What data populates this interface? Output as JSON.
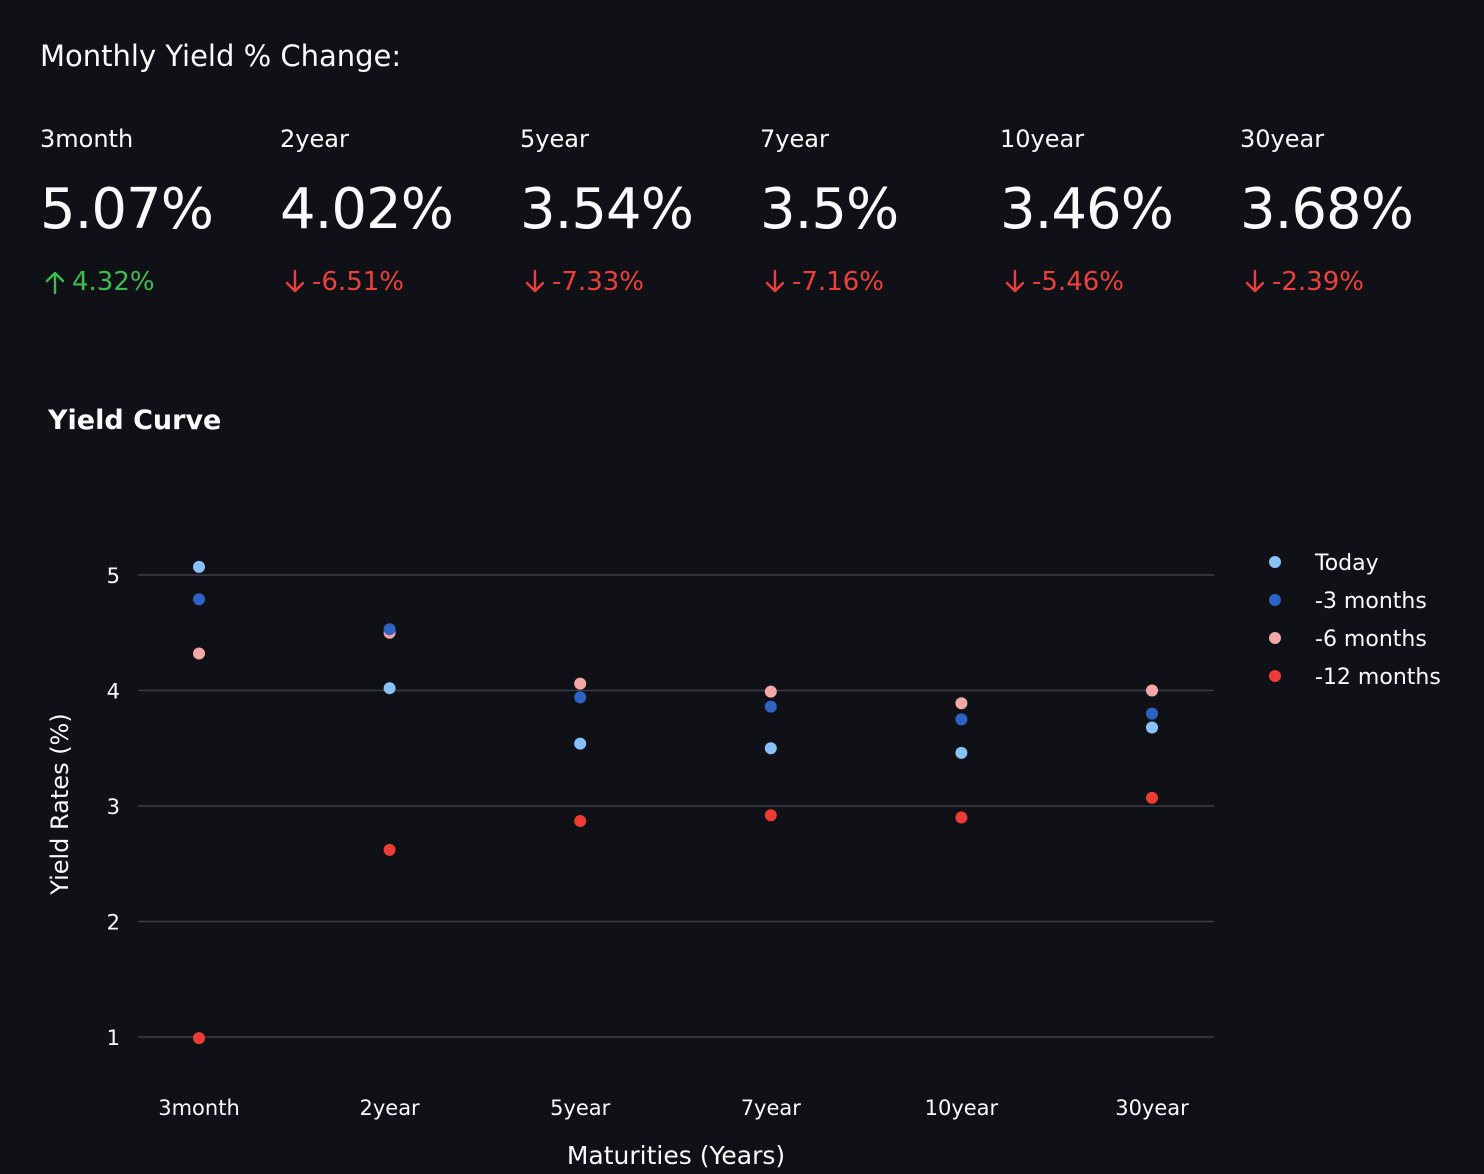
{
  "header": {
    "title": "Monthly Yield % Change:"
  },
  "metrics": [
    {
      "label": "3month",
      "value": "5.07%",
      "delta": "4.32%",
      "direction": "up"
    },
    {
      "label": "2year",
      "value": "4.02%",
      "delta": "-6.51%",
      "direction": "down"
    },
    {
      "label": "5year",
      "value": "3.54%",
      "delta": "-7.33%",
      "direction": "down"
    },
    {
      "label": "7year",
      "value": "3.5%",
      "delta": "-7.16%",
      "direction": "down"
    },
    {
      "label": "10year",
      "value": "3.46%",
      "delta": "-5.46%",
      "direction": "down"
    },
    {
      "label": "30year",
      "value": "3.68%",
      "delta": "-2.39%",
      "direction": "down"
    }
  ],
  "colors": {
    "background": "#0f1116",
    "text": "#fafafa",
    "positive": "#3dbd4f",
    "negative": "#ef3f3a",
    "grid": "#3b3d45"
  },
  "icons": {
    "up": "arrow-up-icon",
    "down": "arrow-down-icon"
  },
  "chart_data": {
    "type": "scatter",
    "title": "Yield Curve",
    "xlabel": "Maturities (Years)",
    "ylabel": "Yield Rates (%)",
    "categories": [
      "3month",
      "2year",
      "5year",
      "7year",
      "10year",
      "30year"
    ],
    "yticks": [
      1,
      2,
      3,
      4,
      5
    ],
    "ylim": [
      0.6,
      5.5
    ],
    "grid": true,
    "legend_position": "right",
    "series": [
      {
        "name": "Today",
        "color": "#89c2f8",
        "values": [
          5.07,
          4.02,
          3.54,
          3.5,
          3.46,
          3.68
        ]
      },
      {
        "name": "-3 months",
        "color": "#2e63c5",
        "values": [
          4.79,
          4.53,
          3.94,
          3.86,
          3.75,
          3.8
        ]
      },
      {
        "name": "-6 months",
        "color": "#f2a8a6",
        "values": [
          4.32,
          4.5,
          4.06,
          3.99,
          3.89,
          4.0
        ]
      },
      {
        "name": "-12 months",
        "color": "#ee3c35",
        "values": [
          0.99,
          2.62,
          2.87,
          2.92,
          2.9,
          3.07
        ]
      }
    ]
  }
}
